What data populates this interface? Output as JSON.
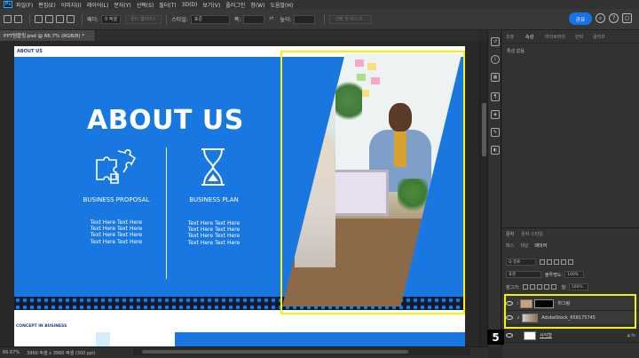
{
  "menu": {
    "logo": "Ps",
    "items": [
      "파일(F)",
      "편집(E)",
      "이미지(I)",
      "레이어(L)",
      "문자(Y)",
      "선택(S)",
      "필터(T)",
      "3D(D)",
      "보기(V)",
      "플러그인",
      "창(W)",
      "도움말(H)"
    ]
  },
  "options": {
    "feather_label": "페더:",
    "feather_value": "0 픽셀",
    "antialias_label": "앤티 앨리어스",
    "style_label": "스타일:",
    "style_value": "표준",
    "width_label": "폭:",
    "height_label": "높이:",
    "select_mask_label": "선택 및 마스크...",
    "share_label": "공유"
  },
  "document": {
    "tab_title": "PPT템플릿.psd @ 66.7% (RGB/8) *"
  },
  "artboard": {
    "header": "ABOUT US",
    "title": "ABOUT US",
    "features": [
      {
        "title": "BUSINESS PROPOSAL",
        "lines": [
          "Text Here Text Here",
          "Text Here Text Here",
          "Text Here Text Here",
          "Text Here Text Here"
        ]
      },
      {
        "title": "BUSINESS PLAN",
        "lines": [
          "Text Here Text Here",
          "Text Here Text Here",
          "Text Here Text Here",
          "Text Here Text Here"
        ]
      }
    ],
    "concept_label": "CONCEPT IN BUSINESS"
  },
  "properties": {
    "tabs": [
      "조정",
      "속성",
      "라이브러리",
      "단락",
      "글리프"
    ],
    "active_tab": "속성",
    "empty_text": "특성 없음"
  },
  "layers": {
    "tabs": [
      "문자",
      "문자 스타일"
    ],
    "subtabs": [
      "패스",
      "채널",
      "레이어"
    ],
    "kind_label": "Q 종류",
    "mode_value": "표준",
    "opacity_label": "불투명도:",
    "opacity_value": "100%",
    "lock_label": "잠그기:",
    "fill_label": "칠:",
    "fill_value": "100%",
    "items": [
      {
        "name": "마그림",
        "selected": false
      },
      {
        "name": "AdobeStock_658175745",
        "selected": false
      },
      {
        "name": "사각형",
        "selected": false
      }
    ]
  },
  "status": {
    "zoom": "66.67%",
    "doc_info": "3960 픽셀 x 3960 픽셀 (300 ppi)"
  },
  "annotation": {
    "step": "5"
  },
  "colors": {
    "accent_blue": "#1877e0",
    "highlight_yellow": "#f5f10a",
    "ps_panel": "#323232"
  }
}
